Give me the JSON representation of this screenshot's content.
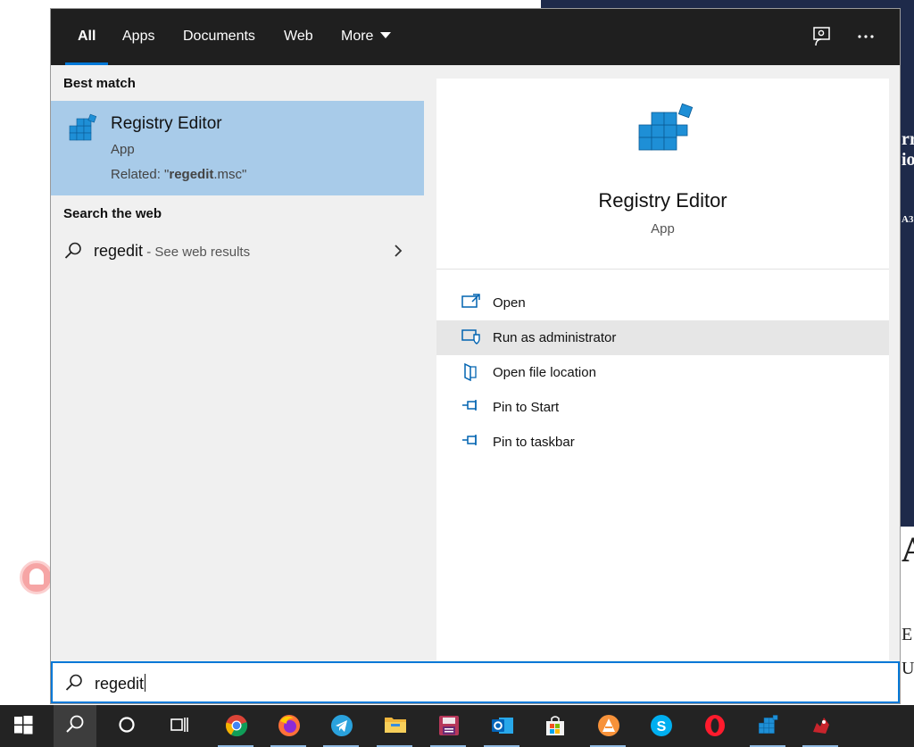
{
  "tabs": [
    {
      "label": "All",
      "active": true
    },
    {
      "label": "Apps"
    },
    {
      "label": "Documents"
    },
    {
      "label": "Web"
    },
    {
      "label": "More"
    }
  ],
  "best_match": {
    "heading": "Best match",
    "title": "Registry Editor",
    "type": "App",
    "related_prefix": "Related: \"",
    "related_bold": "regedit",
    "related_suffix": ".msc\""
  },
  "web": {
    "heading": "Search the web",
    "term": "regedit",
    "suffix": " - See web results"
  },
  "detail": {
    "title": "Registry Editor",
    "type": "App",
    "actions": [
      {
        "label": "Open",
        "icon": "open-icon"
      },
      {
        "label": "Run as administrator",
        "icon": "shield-icon",
        "highlighted": true
      },
      {
        "label": "Open file location",
        "icon": "file-location-icon"
      },
      {
        "label": "Pin to Start",
        "icon": "pin-icon"
      },
      {
        "label": "Pin to taskbar",
        "icon": "pin-icon"
      }
    ]
  },
  "search": {
    "value": "regedit"
  },
  "background": {
    "fragments": [
      "rr",
      "io",
      "A3",
      "A",
      "E",
      "U"
    ]
  },
  "taskbar": {
    "items": [
      "start-icon",
      "search-icon",
      "cortana-icon",
      "task-view-icon",
      "chrome-icon",
      "firefox-icon",
      "telegram-icon",
      "file-explorer-icon",
      "save-app-icon",
      "outlook-icon",
      "store-icon",
      "vlc-icon",
      "skype-icon",
      "opera-icon",
      "registry-editor-icon",
      "game-icon"
    ]
  },
  "colors": {
    "accent": "#0078d7",
    "selection": "#a8cbe9",
    "topbar": "#1f1f1f",
    "taskbar": "#232323"
  }
}
